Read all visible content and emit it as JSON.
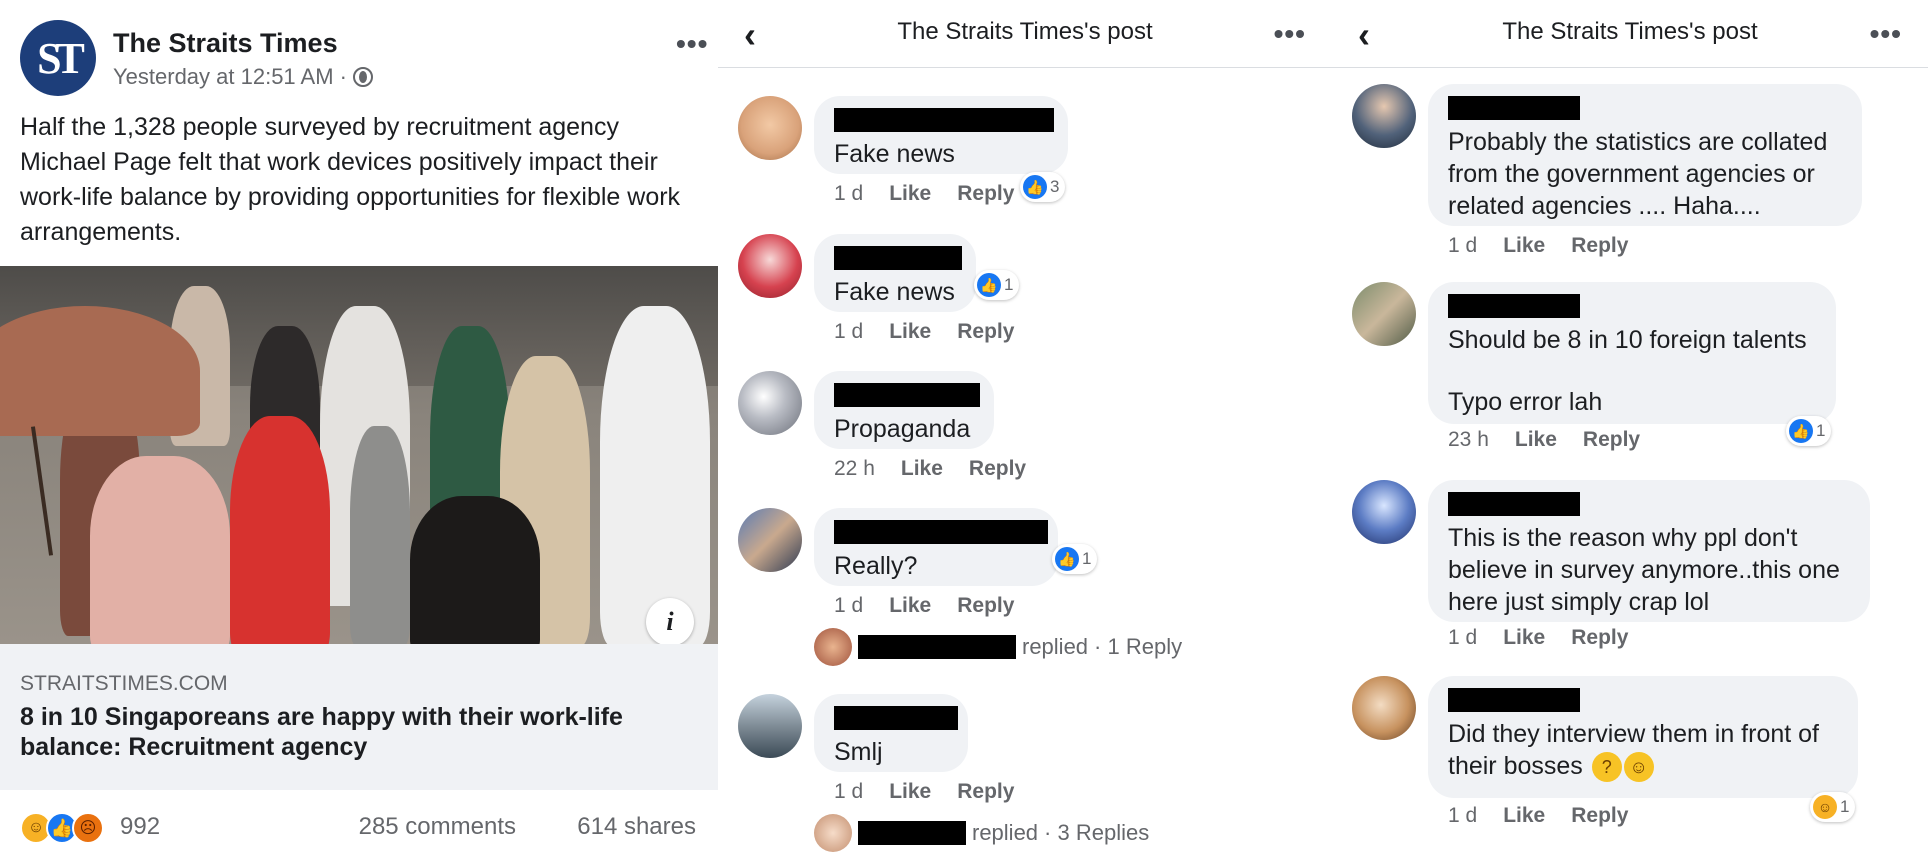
{
  "post": {
    "page_name": "The Straits Times",
    "logo_text": "ST",
    "time": "Yesterday at 12:51 AM ·",
    "more": "•••",
    "text": "Half the 1,328 people surveyed by recruitment agency Michael Page felt that work devices positively impact their work-life balance by providing opportunities for flexible work arrangements.",
    "info": "i",
    "link_domain": "STRAITSTIMES.COM",
    "link_title": "8 in 10 Singaporeans are happy with their work-life balance: Recruitment agency",
    "reaction_count": "992",
    "comments": "285 comments",
    "shares": "614 shares",
    "icons": [
      "haha-icon",
      "like-icon",
      "angry-icon"
    ]
  },
  "panel1": {
    "back": "‹",
    "title": "The Straits Times's post",
    "more": "•••",
    "comments": [
      {
        "text": "Fake news",
        "time": "1 d",
        "like": "Like",
        "reply": "Reply",
        "reactions": "3"
      },
      {
        "text": "Fake news",
        "time": "1 d",
        "like": "Like",
        "reply": "Reply",
        "reactions": "1"
      },
      {
        "text": "Propaganda",
        "time": "22 h",
        "like": "Like",
        "reply": "Reply"
      },
      {
        "text": "Really?",
        "time": "1 d",
        "like": "Like",
        "reply": "Reply",
        "reactions": "1",
        "replied": "replied",
        "reply_count": "· 1 Reply"
      },
      {
        "text": "Smlj",
        "time": "1 d",
        "like": "Like",
        "reply": "Reply",
        "replied": "replied",
        "reply_count": "· 3 Replies"
      }
    ]
  },
  "panel2": {
    "back": "‹",
    "title": "The Straits Times's post",
    "more": "•••",
    "comments": [
      {
        "text": "Probably the statistics are collated from the government agencies or related agencies .... Haha....",
        "time": "1 d",
        "like": "Like",
        "reply": "Reply"
      },
      {
        "text_line1": "Should be 8 in 10 foreign talents",
        "text_line2": "Typo error lah",
        "time": "23 h",
        "like": "Like",
        "reply": "Reply",
        "reactions": "1"
      },
      {
        "text": "This is the reason why ppl don't believe in survey anymore..this one here just simply crap lol",
        "time": "1 d",
        "like": "Like",
        "reply": "Reply"
      },
      {
        "text": "Did they interview them in front of their bosses",
        "time": "1 d",
        "like": "Like",
        "reply": "Reply",
        "reactions": "1"
      }
    ]
  },
  "colors": {
    "accent": "#1877f2",
    "bubble": "#f0f2f5",
    "meta": "#65676b"
  }
}
